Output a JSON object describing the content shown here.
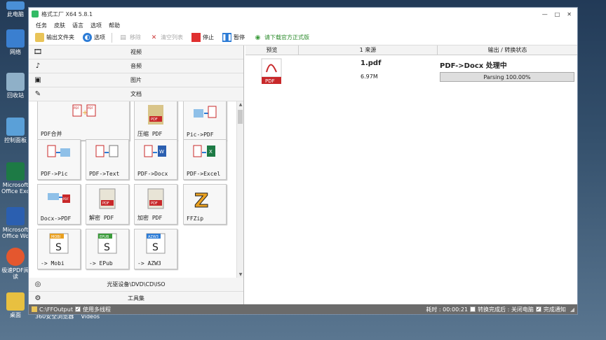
{
  "desktop": {
    "icons": [
      "此电脑",
      "网络",
      "回收站",
      "控制面板",
      "Microsoft Office Exc",
      "Microsoft Office Wo",
      "极速PDF阅读",
      "桌面"
    ],
    "taskbar_labels": [
      "360安全浏览器",
      "Videos"
    ]
  },
  "window": {
    "title": "格式工厂 X64 5.8.1",
    "controls": [
      "—",
      "□",
      "✕"
    ]
  },
  "menu": [
    "任务",
    "皮肤",
    "语言",
    "选项",
    "帮助"
  ],
  "toolbar": {
    "output_folder": "输出文件夹",
    "options": "选项",
    "remove": "移除",
    "clear_list": "清空列表",
    "stop": "停止",
    "pause": "暂停",
    "download": "请下载官方正式版"
  },
  "categories": {
    "video": "视频",
    "audio": "音频",
    "image": "图片",
    "document": "文档",
    "optical": "光驱设备\\DVD\\CD\\ISO",
    "tools": "工具集"
  },
  "tiles": [
    {
      "label": "PDF合并"
    },
    {
      "label": "压缩 PDF"
    },
    {
      "label": "Pic->PDF"
    },
    {
      "label": "PDF->Pic"
    },
    {
      "label": "PDF->Text"
    },
    {
      "label": "PDF->Docx"
    },
    {
      "label": "PDF->Excel"
    },
    {
      "label": "Docx->PDF"
    },
    {
      "label": "解密 PDF"
    },
    {
      "label": "加密 PDF"
    },
    {
      "label": "FFZip"
    },
    {
      "label": "-> Mobi"
    },
    {
      "label": "-> EPub"
    },
    {
      "label": "-> AZW3"
    }
  ],
  "task_table": {
    "headers": [
      "预览",
      "1 来源",
      "输出 / 转换状态"
    ],
    "rows": [
      {
        "file": "1.pdf",
        "size": "6.97M",
        "status": "PDF->Docx 处理中",
        "progress_text": "Parsing 100.00%",
        "progress": 1.0
      }
    ]
  },
  "statusbar": {
    "path": "C:\\FFOutput",
    "multithread": "使用多线程",
    "elapsed": "耗时 : 00:00:21",
    "after_done": "转换完成后 : 关闭电脑",
    "notify": "完成通知"
  },
  "colors": {
    "accent": "#2b7bd6",
    "pdf_red": "#c8282a",
    "statusbar_bg": "#6b6b6b"
  }
}
